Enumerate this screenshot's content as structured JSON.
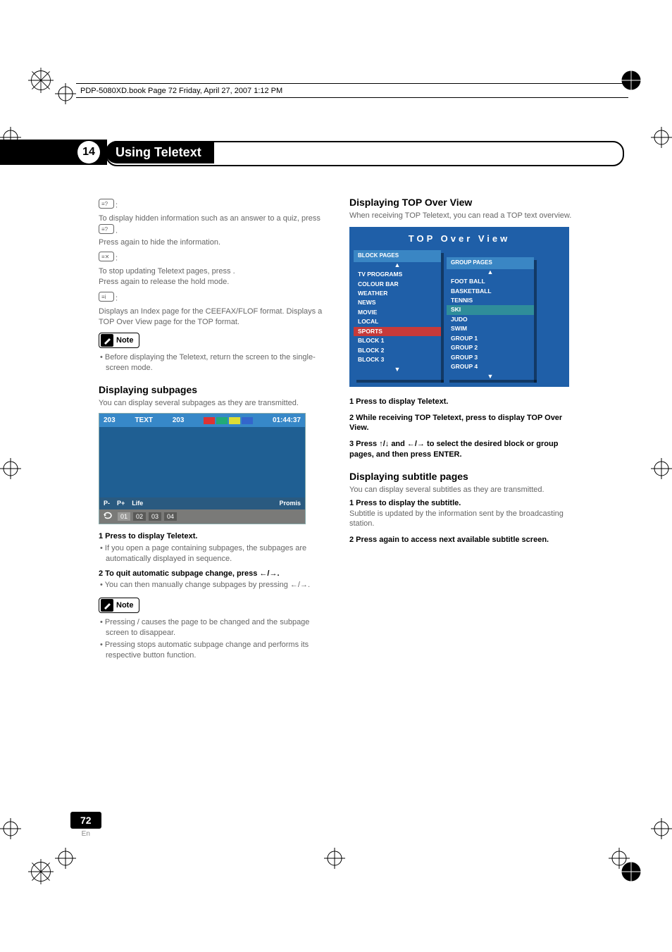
{
  "header_path": "PDP-5080XD.book  Page 72  Friday, April 27, 2007  1:12 PM",
  "chapter": {
    "number": "14",
    "title": "Using Teletext"
  },
  "icons": {
    "reveal_desc": "To display hidden information such as an answer to a quiz, press",
    "reveal_desc2": ".",
    "reveal_again": "Press        again to hide the information.",
    "hold_desc": "To stop updating Teletext pages, press        .",
    "hold_again": "Press        again to release the hold mode.",
    "index_desc": "Displays an Index page for the CEEFAX/FLOF format. Displays a TOP Over View page for the TOP format."
  },
  "note1": "Before displaying the Teletext, return the screen to the single-screen mode.",
  "subpages": {
    "heading": "Displaying subpages",
    "intro": "You can display several subpages as they are transmitted.",
    "step1": "1   Press        to display Teletext.",
    "step1_sub": "If you open a page containing subpages, the subpages are automatically displayed in sequence.",
    "step2": "2   To quit automatic subpage change, press ←/→.",
    "step2_sub": "You can then manually change subpages by pressing ←/→.",
    "note_a": "Pressing        /        causes the page to be changed and the subpage screen to disappear.",
    "note_b": "Pressing        stops automatic subpage change and performs its respective button function."
  },
  "ttx": {
    "page_left": "203",
    "text_label": "TEXT",
    "page_mid": "203",
    "time": "01:44:37",
    "colors": [
      "#d33",
      "#2a7",
      "#dd3",
      "#36c"
    ],
    "footer1": [
      "P-",
      "P+",
      "Life",
      "",
      "Promis"
    ],
    "subpages": [
      "01",
      "02",
      "03",
      "04"
    ]
  },
  "topview": {
    "heading": "Displaying TOP Over View",
    "intro": "When receiving TOP Teletext, you can read a TOP text overview.",
    "title": "TOP Over View",
    "block_head": "BLOCK PAGES",
    "group_head": "GROUP PAGES",
    "block_items": [
      "TV PROGRAMS",
      "COLOUR BAR",
      "WEATHER",
      "NEWS",
      "MOVIE",
      "LOCAL",
      "SPORTS",
      "BLOCK 1",
      "BLOCK 2",
      "BLOCK 3"
    ],
    "block_hl_index": 6,
    "group_items": [
      "FOOT BALL",
      "BASKETBALL",
      "TENNIS",
      "SKI",
      "JUDO",
      "SWIM",
      "GROUP 1",
      "GROUP 2",
      "GROUP 3",
      "GROUP 4"
    ],
    "group_hl_index": 3,
    "step1": "1   Press        to display Teletext.",
    "step2": "2   While receiving TOP Teletext, press        to display TOP Over View.",
    "step3": "3   Press ↑/↓ and ←/→ to select the desired block or group pages, and then press ENTER."
  },
  "subtitle": {
    "heading": "Displaying subtitle pages",
    "intro": "You can display several subtitles as they are transmitted.",
    "step1": "1   Press        to display the subtitle.",
    "step1_sub": "Subtitle is updated by the information sent by the broadcasting station.",
    "step2": "2   Press        again to access next available subtitle screen."
  },
  "note_label": "Note",
  "page_number": "72",
  "page_lang": "En"
}
